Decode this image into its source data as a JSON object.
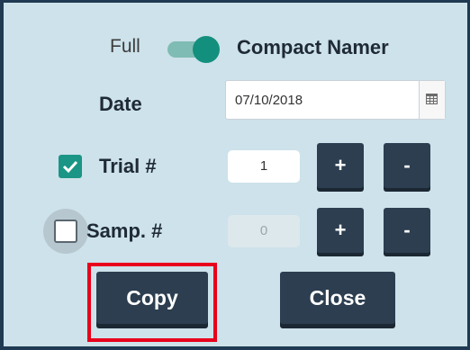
{
  "header": {
    "full_label": "Full",
    "mode_label": "Compact Namer"
  },
  "toggle": {
    "state": "on",
    "color": "#138f7d"
  },
  "date": {
    "label": "Date",
    "value": "07/10/2018",
    "icon": "calendar-icon"
  },
  "trial": {
    "label": "Trial #",
    "checked": true,
    "value": "1",
    "plus_label": "+",
    "minus_label": "-"
  },
  "sample": {
    "label": "Samp. #",
    "checked": false,
    "value": "0",
    "plus_label": "+",
    "minus_label": "-"
  },
  "actions": {
    "copy_label": "Copy",
    "close_label": "Close"
  },
  "colors": {
    "background": "#cde2ea",
    "button": "#2c3e50",
    "accent": "#1b9585",
    "highlight": "#e8001c"
  }
}
